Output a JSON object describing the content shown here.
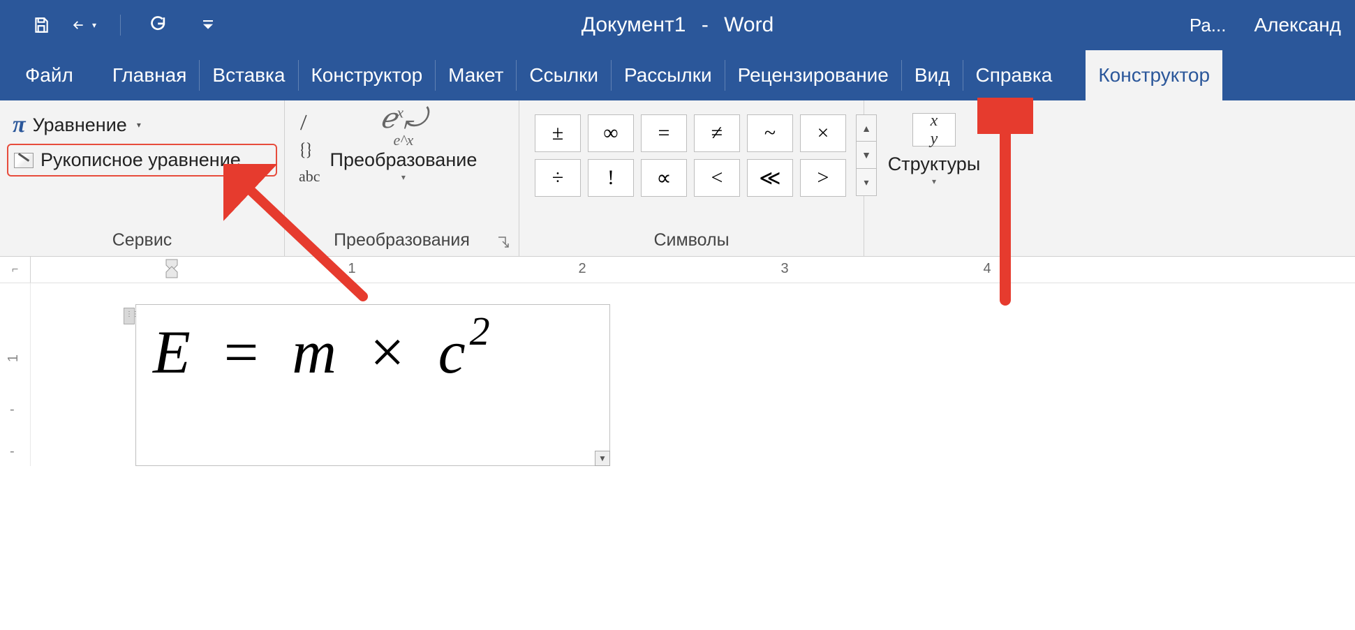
{
  "titlebar": {
    "doc_name": "Документ1",
    "app_name": "Word",
    "truncated_contextual": "Ра...",
    "user_name": "Александ"
  },
  "tabs": {
    "file": "Файл",
    "items": [
      "Главная",
      "Вставка",
      "Конструктор",
      "Макет",
      "Ссылки",
      "Рассылки",
      "Рецензирование",
      "Вид",
      "Справка"
    ],
    "active": "Конструктор"
  },
  "ribbon": {
    "group_tools": {
      "equation": "Уравнение",
      "ink_equation": "Рукописное уравнение",
      "label": "Сервис"
    },
    "group_convert": {
      "slash": "/",
      "braces": "{}",
      "abc": "abc",
      "button": "Преобразование",
      "label": "Преобразования"
    },
    "group_symbols": {
      "row1": [
        "±",
        "∞",
        "=",
        "≠",
        "~",
        "×"
      ],
      "row2": [
        "÷",
        "!",
        "∝",
        "<",
        "≪",
        ">"
      ],
      "label": "Символы"
    },
    "group_structures": {
      "button": "Структуры"
    }
  },
  "ruler": {
    "marks": [
      "1",
      "2",
      "3",
      "4"
    ]
  },
  "vruler": {
    "marks": [
      "1"
    ]
  },
  "document": {
    "equation_parts": {
      "E": "E",
      "eq": "=",
      "m": "m",
      "times": "×",
      "c": "c",
      "sq": "2"
    }
  }
}
